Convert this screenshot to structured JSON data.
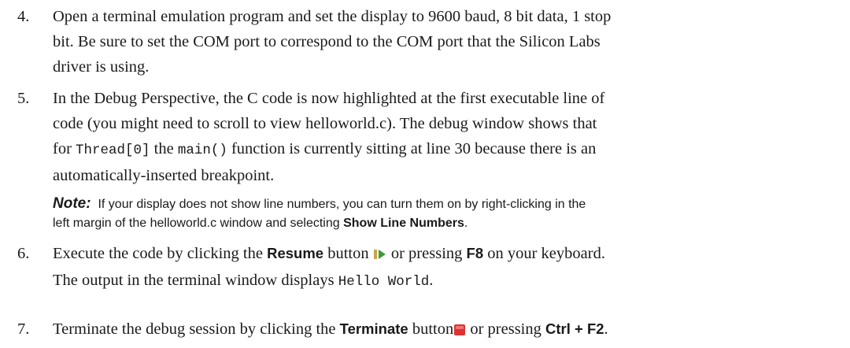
{
  "steps": [
    {
      "number": "4.",
      "lines": [
        "Open a terminal emulation program and set the display to 9600 baud, 8 bit data, 1 stop",
        "bit. Be sure to set the COM port to correspond to the COM port that the Silicon Labs",
        "driver is using."
      ]
    },
    {
      "number": "5.",
      "line1": "In the Debug Perspective, the C code is now highlighted at the first executable line of",
      "line2": "code (you might need to scroll to view helloworld.c). The debug window shows that",
      "line3_pre": "for ",
      "line3_code1": "Thread[0]",
      "line3_mid": " the ",
      "line3_code2": "main()",
      "line3_post": " function is currently sitting at line 30 because there is an",
      "line4": "automatically-inserted breakpoint."
    },
    {
      "number": "6.",
      "pre": "Execute the code by clicking the ",
      "bold1": "Resume",
      "mid1": " button ",
      "mid2": " or pressing ",
      "bold2": "F8",
      "post": " on your keyboard.",
      "cont_pre": "The output in the terminal window displays ",
      "cont_code": "Hello World",
      "cont_post": "."
    },
    {
      "number": "7.",
      "pre": "Terminate the debug session by clicking the ",
      "bold1": "Terminate",
      "mid1": " button",
      "mid2": " or pressing ",
      "bold2": "Ctrl + F2",
      "post": "."
    }
  ],
  "note": {
    "label": "Note:",
    "line1": "If your display does not show line numbers, you can turn them on by right-clicking in the",
    "line2_pre": "left margin of the helloworld.c window and selecting ",
    "line2_bold": "Show Line Numbers",
    "line2_post": "."
  },
  "colors": {
    "resume_icon_bar": "#c9a24a",
    "resume_icon_arrow": "#3f9a3a",
    "terminate_icon": "#e03131"
  },
  "icons": {
    "resume": "resume-icon",
    "terminate": "terminate-icon"
  }
}
